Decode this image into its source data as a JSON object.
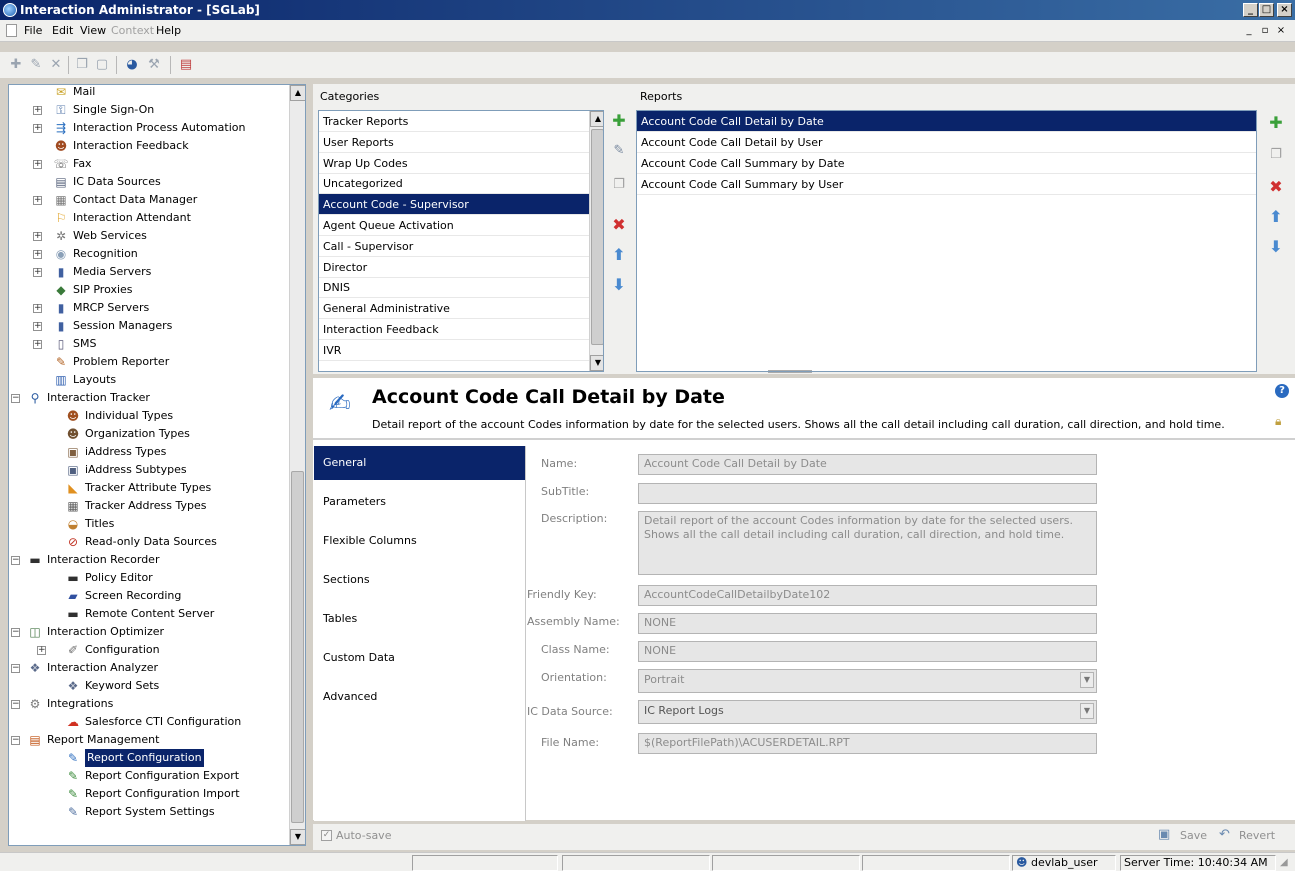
{
  "window": {
    "title": "Interaction Administrator - [SGLab]"
  },
  "menu": {
    "file": "File",
    "edit": "Edit",
    "view": "View",
    "context": "Context",
    "help": "Help"
  },
  "tree": {
    "items": [
      {
        "label": "Mail",
        "icon": "envelope-icon",
        "glyph": "✉",
        "color": "#c9a227",
        "level": 3,
        "expander": ""
      },
      {
        "label": "Single Sign-On",
        "icon": "key-icon",
        "glyph": "⚿",
        "color": "#5577aa",
        "level": 3,
        "expander": "+"
      },
      {
        "label": "Interaction Process Automation",
        "icon": "flow-icon",
        "glyph": "⇶",
        "color": "#2a6fc0",
        "level": 3,
        "expander": "+"
      },
      {
        "label": "Interaction Feedback",
        "icon": "people-icon",
        "glyph": "☻",
        "color": "#a04a20",
        "level": 3,
        "expander": ""
      },
      {
        "label": "Fax",
        "icon": "fax-icon",
        "glyph": "☏",
        "color": "#6b6b6b",
        "level": 3,
        "expander": "+"
      },
      {
        "label": "IC Data Sources",
        "icon": "database-icon",
        "glyph": "▤",
        "color": "#55607a",
        "level": 3,
        "expander": ""
      },
      {
        "label": "Contact Data Manager",
        "icon": "contacts-icon",
        "glyph": "▦",
        "color": "#7a7a7a",
        "level": 3,
        "expander": "+"
      },
      {
        "label": "Interaction Attendant",
        "icon": "attendant-icon",
        "glyph": "⚐",
        "color": "#e0a020",
        "level": 3,
        "expander": ""
      },
      {
        "label": "Web Services",
        "icon": "web-services-icon",
        "glyph": "✲",
        "color": "#777777",
        "level": 3,
        "expander": "+"
      },
      {
        "label": "Recognition",
        "icon": "recognition-icon",
        "glyph": "◉",
        "color": "#8aa0b8",
        "level": 3,
        "expander": "+"
      },
      {
        "label": "Media Servers",
        "icon": "server-icon",
        "glyph": "▮",
        "color": "#4060a0",
        "level": 3,
        "expander": "+"
      },
      {
        "label": "SIP Proxies",
        "icon": "sip-proxy-icon",
        "glyph": "◆",
        "color": "#3a7a3a",
        "level": 3,
        "expander": ""
      },
      {
        "label": "MRCP Servers",
        "icon": "server-icon",
        "glyph": "▮",
        "color": "#4060a0",
        "level": 3,
        "expander": "+"
      },
      {
        "label": "Session Managers",
        "icon": "server-icon",
        "glyph": "▮",
        "color": "#4060a0",
        "level": 3,
        "expander": "+"
      },
      {
        "label": "SMS",
        "icon": "sms-icon",
        "glyph": "▯",
        "color": "#5a5a7a",
        "level": 3,
        "expander": "+"
      },
      {
        "label": "Problem Reporter",
        "icon": "problem-reporter-icon",
        "glyph": "✎",
        "color": "#b06020",
        "level": 3,
        "expander": ""
      },
      {
        "label": "Layouts",
        "icon": "layouts-icon",
        "glyph": "▥",
        "color": "#3060b0",
        "level": 3,
        "expander": ""
      },
      {
        "label": "Interaction Tracker",
        "icon": "magnifier-icon",
        "glyph": "⚲",
        "color": "#2a5aa0",
        "level": 1,
        "expander": "−"
      },
      {
        "label": "Individual Types",
        "icon": "person-icon",
        "glyph": "☻",
        "color": "#a05020",
        "level": 2,
        "expander": ""
      },
      {
        "label": "Organization Types",
        "icon": "organization-icon",
        "glyph": "☻",
        "color": "#705030",
        "level": 2,
        "expander": ""
      },
      {
        "label": "iAddress Types",
        "icon": "address-icon",
        "glyph": "▣",
        "color": "#806040",
        "level": 2,
        "expander": ""
      },
      {
        "label": "iAddress Subtypes",
        "icon": "address-subtype-icon",
        "glyph": "▣",
        "color": "#506080",
        "level": 2,
        "expander": ""
      },
      {
        "label": "Tracker Attribute Types",
        "icon": "tag-icon",
        "glyph": "◣",
        "color": "#e09020",
        "level": 2,
        "expander": ""
      },
      {
        "label": "Tracker Address Types",
        "icon": "grid-icon",
        "glyph": "▦",
        "color": "#606060",
        "level": 2,
        "expander": ""
      },
      {
        "label": "Titles",
        "icon": "titles-icon",
        "glyph": "◒",
        "color": "#c08030",
        "level": 2,
        "expander": ""
      },
      {
        "label": "Read-only Data Sources",
        "icon": "readonly-source-icon",
        "glyph": "⊘",
        "color": "#c03020",
        "level": 2,
        "expander": ""
      },
      {
        "label": "Interaction Recorder",
        "icon": "recorder-icon",
        "glyph": "▬",
        "color": "#303030",
        "level": 1,
        "expander": "−"
      },
      {
        "label": "Policy Editor",
        "icon": "policy-editor-icon",
        "glyph": "▬",
        "color": "#303030",
        "level": 2,
        "expander": ""
      },
      {
        "label": "Screen Recording",
        "icon": "screen-recording-icon",
        "glyph": "▰",
        "color": "#3050a0",
        "level": 2,
        "expander": ""
      },
      {
        "label": "Remote Content Server",
        "icon": "content-server-icon",
        "glyph": "▬",
        "color": "#303030",
        "level": 2,
        "expander": ""
      },
      {
        "label": "Interaction Optimizer",
        "icon": "optimizer-icon",
        "glyph": "◫",
        "color": "#4a7a4a",
        "level": 1,
        "expander": "−"
      },
      {
        "label": "Configuration",
        "icon": "wrench-icon",
        "glyph": "✐",
        "color": "#707070",
        "level": 2,
        "expander": "+"
      },
      {
        "label": "Interaction Analyzer",
        "icon": "analyzer-icon",
        "glyph": "❖",
        "color": "#5a6a8a",
        "level": 1,
        "expander": "−"
      },
      {
        "label": "Keyword Sets",
        "icon": "keyword-sets-icon",
        "glyph": "❖",
        "color": "#5a6a8a",
        "level": 2,
        "expander": ""
      },
      {
        "label": "Integrations",
        "icon": "integrations-icon",
        "glyph": "⚙",
        "color": "#7a7a7a",
        "level": 1,
        "expander": "−"
      },
      {
        "label": "Salesforce CTI Configuration",
        "icon": "salesforce-icon",
        "glyph": "☁",
        "color": "#d03020",
        "level": 2,
        "expander": ""
      },
      {
        "label": "Report Management",
        "icon": "report-management-icon",
        "glyph": "▤",
        "color": "#c05010",
        "level": 1,
        "expander": "−"
      },
      {
        "label": "Report Configuration",
        "icon": "report-config-icon",
        "glyph": "✎",
        "color": "#3070c0",
        "level": 2,
        "expander": "",
        "selected": true
      },
      {
        "label": "Report Configuration Export",
        "icon": "report-export-icon",
        "glyph": "✎",
        "color": "#3a8a3a",
        "level": 2,
        "expander": ""
      },
      {
        "label": "Report Configuration Import",
        "icon": "report-import-icon",
        "glyph": "✎",
        "color": "#3a8a3a",
        "level": 2,
        "expander": ""
      },
      {
        "label": "Report System Settings",
        "icon": "report-settings-icon",
        "glyph": "✎",
        "color": "#5070a0",
        "level": 2,
        "expander": ""
      }
    ]
  },
  "categories": {
    "label": "Categories",
    "items": [
      "Tracker Reports",
      "User Reports",
      "Wrap Up Codes",
      "Uncategorized",
      "Account Code - Supervisor",
      "Agent Queue Activation",
      "Call - Supervisor",
      "Director",
      "DNIS",
      "General Administrative",
      "Interaction Feedback",
      "IVR"
    ],
    "selected_index": 4
  },
  "reports": {
    "label": "Reports",
    "items": [
      "Account Code Call Detail by Date",
      "Account Code Call Detail by User",
      "Account Code Call Summary by Date",
      "Account Code Call Summary by User"
    ],
    "selected_index": 0
  },
  "detail": {
    "title": "Account Code Call Detail by Date",
    "description": "Detail report of the account Codes information by date for the selected users. Shows all the call detail including call duration, call direction, and hold time."
  },
  "nav": {
    "items": [
      "General",
      "Parameters",
      "Flexible Columns",
      "Sections",
      "Tables",
      "Custom Data",
      "Advanced"
    ],
    "selected_index": 0
  },
  "form": {
    "name_label": "Name:",
    "name": "Account Code Call Detail by Date",
    "subtitle_label": "SubTitle:",
    "subtitle": "",
    "description_label": "Description:",
    "description": "Detail report of the account Codes information by date for the selected users. Shows all the call detail including call duration, call direction, and hold time.",
    "friendly_key_label": "Friendly Key:",
    "friendly_key": "AccountCodeCallDetailbyDate102",
    "assembly_label": "Assembly Name:",
    "assembly": "NONE",
    "class_label": "Class Name:",
    "class_name": "NONE",
    "orientation_label": "Orientation:",
    "orientation": "Portrait",
    "data_source_label": "IC Data Source:",
    "data_source": "IC Report Logs",
    "file_name_label": "File Name:",
    "file_name": "$(ReportFilePath)\\ACUSERDETAIL.RPT"
  },
  "footer": {
    "autosave": "Auto-save",
    "save": "Save",
    "revert": "Revert"
  },
  "status": {
    "user": "devlab_user",
    "server_time": "Server Time: 10:40:34 AM"
  }
}
